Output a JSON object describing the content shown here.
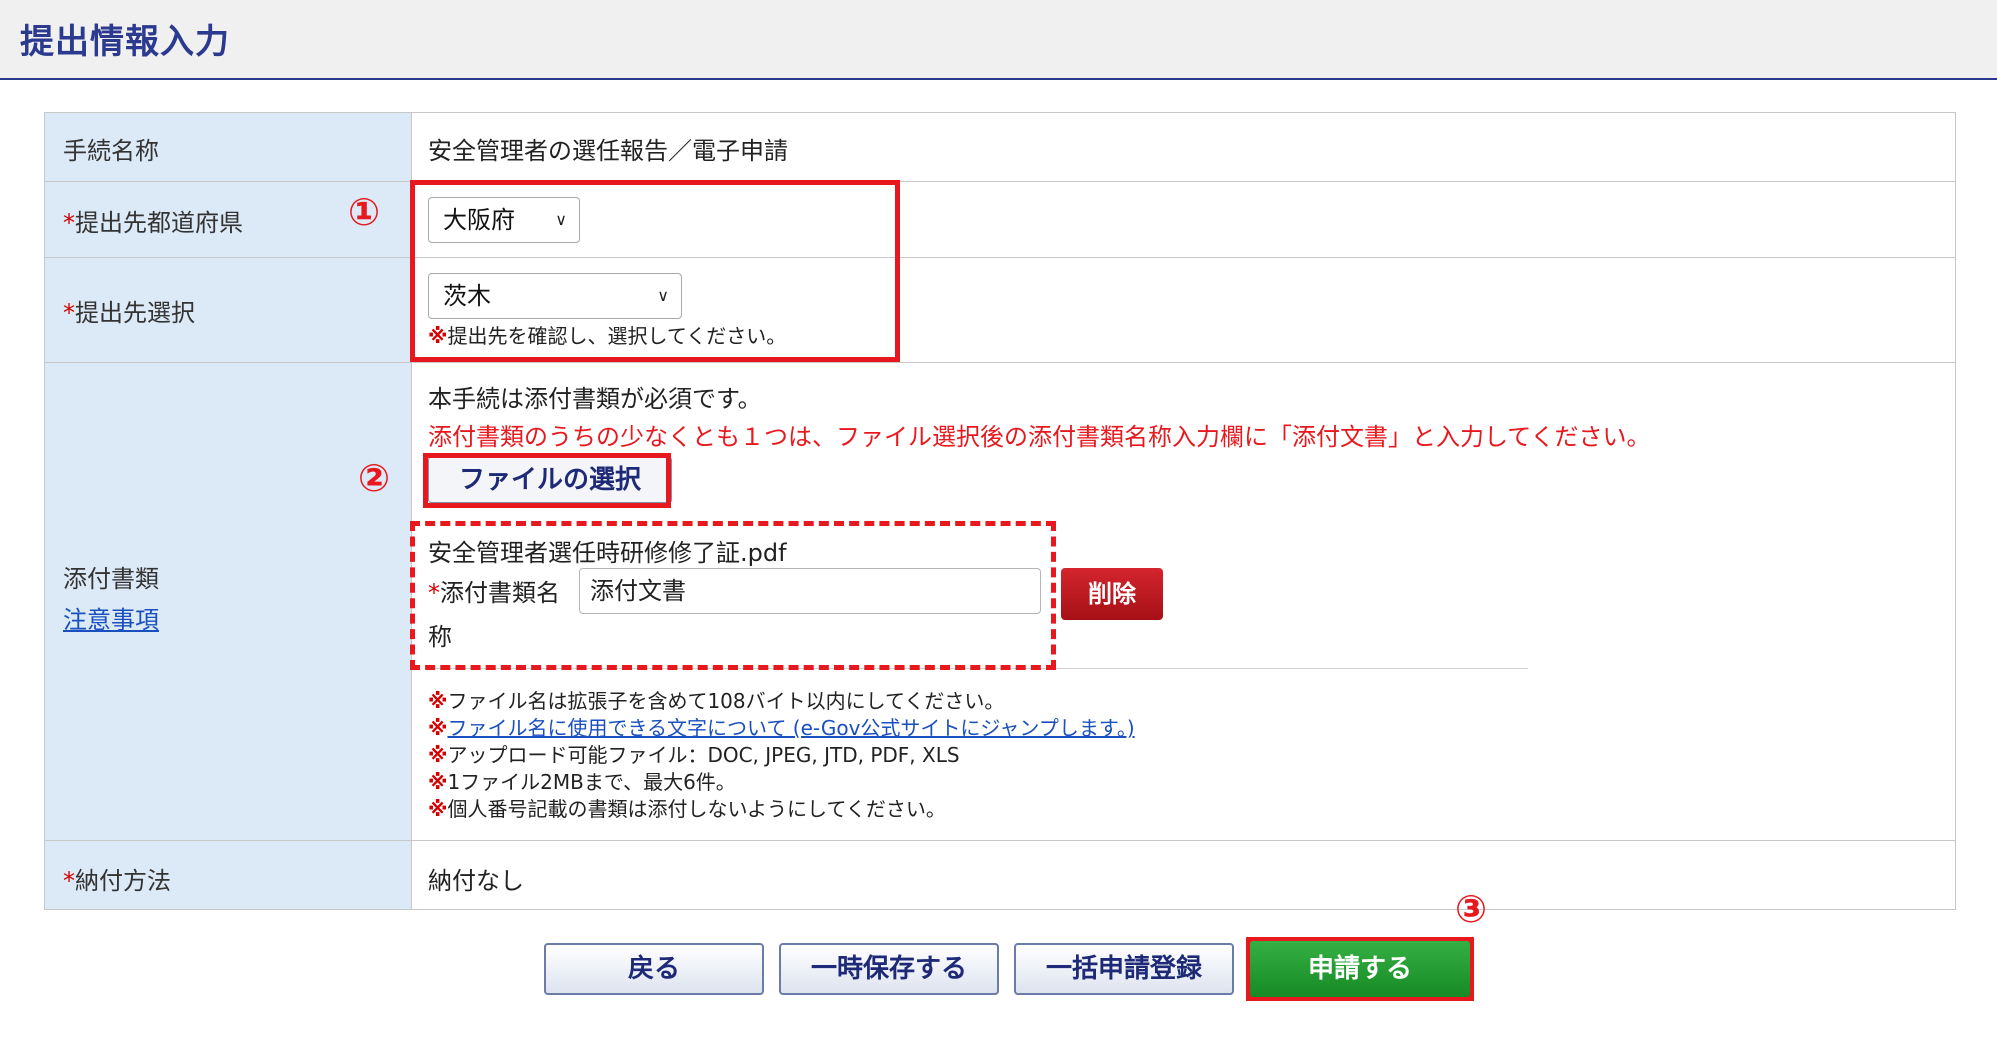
{
  "header": {
    "title": "提出情報入力"
  },
  "form": {
    "procedure": {
      "label": "手続名称",
      "value": "安全管理者の選任報告／電子申請"
    },
    "prefecture": {
      "required_mark": "*",
      "label": "提出先都道府県",
      "selected": "大阪府"
    },
    "destination": {
      "required_mark": "*",
      "label": "提出先選択",
      "selected": "茨木",
      "note_mark": "※",
      "note": "提出先を確認し、選択してください。"
    },
    "attachments": {
      "label": "添付書類",
      "caution_link": "注意事項",
      "intro": "本手続は添付書類が必須です。",
      "warning": "添付書類のうちの少なくとも１つは、ファイル選択後の添付書類名称入力欄に「添付文書」と入力してください。",
      "file_button": "ファイルの選択",
      "file_name": "安全管理者選任時研修修了証.pdf",
      "name_label_mark": "*",
      "name_label": "添付書類名",
      "name_label_wrap": "称",
      "name_value": "添付文書",
      "delete_button": "削除",
      "notes": [
        {
          "mark": "※",
          "text": "ファイル名は拡張子を含めて108バイト以内にしてください。",
          "is_link": false
        },
        {
          "mark": "※",
          "text": "ファイル名に使用できる文字について (e-Gov公式サイトにジャンプします。)",
          "is_link": true
        },
        {
          "mark": "※",
          "text": "アップロード可能ファイル：DOC, JPEG, JTD, PDF, XLS",
          "is_link": false
        },
        {
          "mark": "※",
          "text": "1ファイル2MBまで、最大6件。",
          "is_link": false
        },
        {
          "mark": "※",
          "text": "個人番号記載の書類は添付しないようにしてください。",
          "is_link": false
        }
      ]
    },
    "payment": {
      "required_mark": "*",
      "label": "納付方法",
      "value": "納付なし"
    }
  },
  "buttons": {
    "back": "戻る",
    "save": "一時保存する",
    "batch": "一括申請登録",
    "submit": "申請する"
  },
  "callouts": {
    "one": "①",
    "two": "②",
    "three": "③"
  },
  "colors": {
    "accent": "#2b3a8f",
    "label_bg": "#dce9f7",
    "annotation": "#e8191e",
    "submit": "#178a25",
    "delete": "#b81a20"
  }
}
